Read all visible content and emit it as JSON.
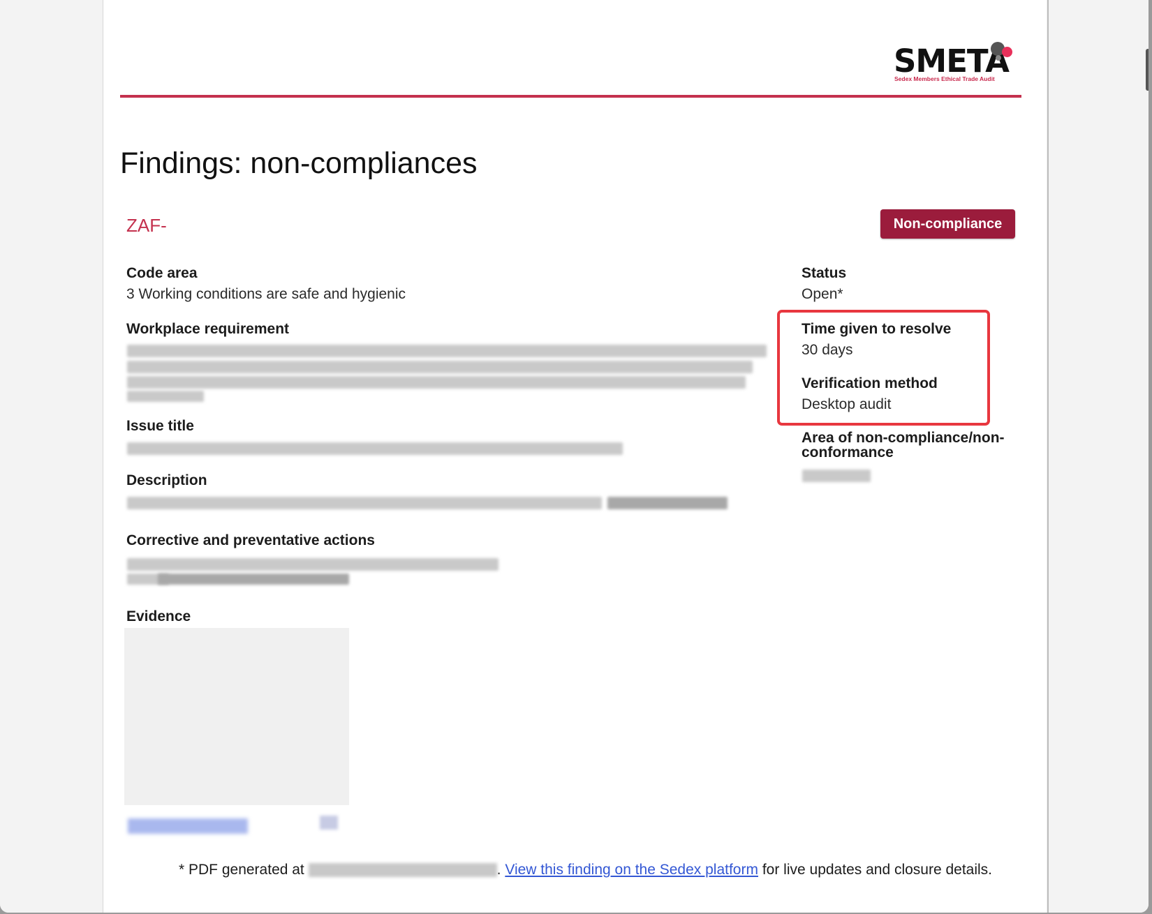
{
  "header": {
    "logo_text": "SMETA",
    "logo_tagline": "Sedex Members Ethical Trade Audit",
    "colors": {
      "accent": "#c4314e",
      "badge": "#9b1c3c",
      "highlight": "#e8373f",
      "link": "#3357d4"
    }
  },
  "page": {
    "title": "Findings: non-compliances"
  },
  "finding": {
    "id": "ZAF-",
    "badge": "Non-compliance",
    "code_area_label": "Code area",
    "code_area_value": "3 Working conditions are safe and hygienic",
    "workplace_requirement_label": "Workplace requirement",
    "issue_title_label": "Issue title",
    "description_label": "Description",
    "corrective_actions_label": "Corrective and preventative actions",
    "evidence_label": "Evidence",
    "status_label": "Status",
    "status_value": "Open*",
    "time_to_resolve_label": "Time given to resolve",
    "time_to_resolve_value": "30 days",
    "verification_method_label": "Verification method",
    "verification_method_value": "Desktop audit",
    "area_label_line1": "Area of non-compliance/non-",
    "area_label_line2": "conformance"
  },
  "footer": {
    "prefix": "* PDF generated at",
    "link_text": "View this finding on the Sedex platform",
    "suffix": "for live updates and closure details."
  }
}
